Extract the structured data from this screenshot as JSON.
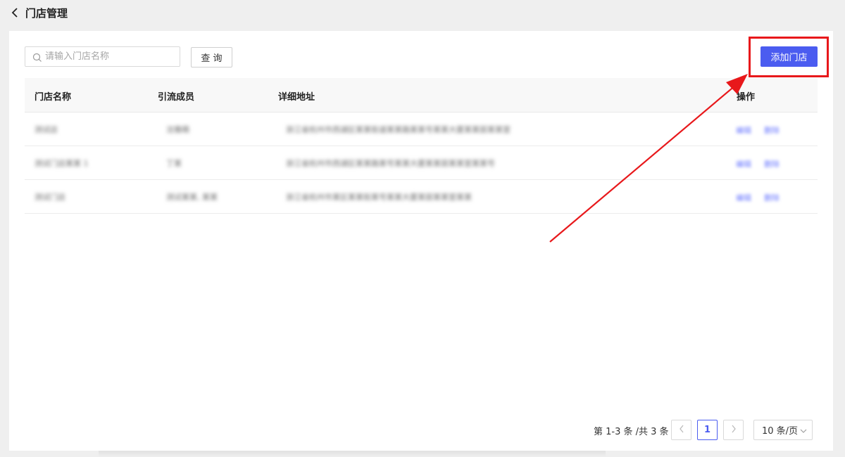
{
  "header": {
    "title": "门店管理",
    "back_icon": "chevron-left-icon"
  },
  "toolbar": {
    "search_placeholder": "请输入门店名称",
    "search_value": "",
    "query_label": "查 询",
    "add_label": "添加门店"
  },
  "table": {
    "columns": [
      "门店名称",
      "引流成员",
      "详细地址",
      "操作"
    ],
    "rows": [
      {
        "name": "测试店",
        "member": "沈雅萌",
        "address": "浙江省杭州市西湖区某某街道某某路某某号某某大厦某某层某某室",
        "actions": [
          "编辑",
          "删除"
        ]
      },
      {
        "name": "测试门店某某 1",
        "member": "丁某",
        "address": "浙江省杭州市西湖区某某路某号某某大厦某某层某某室某某号",
        "actions": [
          "编辑",
          "删除"
        ]
      },
      {
        "name": "测试门店",
        "member": "测试某某, 某某",
        "address": "浙江省杭州市某区某某街某号某某大厦某层某某室某某",
        "actions": [
          "编辑",
          "删除"
        ]
      }
    ]
  },
  "pagination": {
    "summary": "第 1-3 条 /共 3 条",
    "prev_icon": "chevron-left-icon",
    "current_page": "1",
    "next_icon": "chevron-right-icon",
    "page_size": "10 条/页"
  },
  "colors": {
    "primary": "#4b5cf0",
    "annotation": "#e8181b"
  }
}
